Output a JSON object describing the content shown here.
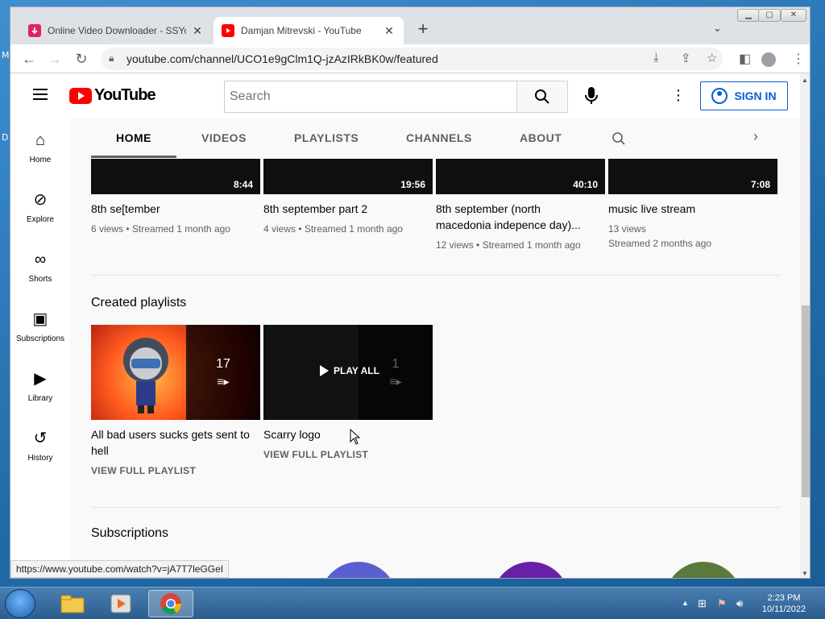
{
  "desktop": {
    "fragments": [
      "M",
      "D"
    ]
  },
  "browser": {
    "tabs": [
      {
        "title": "Online Video Downloader - SSYo",
        "active": false
      },
      {
        "title": "Damjan Mitrevski - YouTube",
        "active": true
      }
    ],
    "new_tab": "+",
    "url": "youtube.com/channel/UCO1e9gClm1Q-jzAzIRkBK0w/featured",
    "status_url": "https://www.youtube.com/watch?v=jA7T7leGGeI"
  },
  "yt": {
    "logo_text": "YouTube",
    "search_placeholder": "Search",
    "sign_in": "SIGN IN",
    "guide": [
      {
        "label": "Home",
        "icon": "home-icon"
      },
      {
        "label": "Explore",
        "icon": "compass-icon"
      },
      {
        "label": "Shorts",
        "icon": "shorts-icon"
      },
      {
        "label": "Subscriptions",
        "icon": "subscriptions-icon"
      },
      {
        "label": "Library",
        "icon": "library-icon"
      },
      {
        "label": "History",
        "icon": "history-icon"
      }
    ],
    "channel_tabs": [
      "HOME",
      "VIDEOS",
      "PLAYLISTS",
      "CHANNELS",
      "ABOUT"
    ],
    "videos": [
      {
        "title": "8th se[tember",
        "duration": "8:44",
        "views": "6 views",
        "streamed": "Streamed 1 month ago"
      },
      {
        "title": "8th september part 2",
        "duration": "19:56",
        "views": "4 views",
        "streamed": "Streamed 1 month ago"
      },
      {
        "title": "8th september (north macedonia indepence day)...",
        "duration": "40:10",
        "views": "12 views",
        "streamed": "Streamed 1 month ago"
      },
      {
        "title": "music live stream",
        "duration": "7:08",
        "views": "13 views",
        "streamed": "Streamed 2 months ago"
      }
    ],
    "created_playlists_heading": "Created playlists",
    "playlists": [
      {
        "title": "All bad users sucks gets sent to hell",
        "count": "17",
        "link": "VIEW FULL PLAYLIST"
      },
      {
        "title": "Scarry logo",
        "count": "1",
        "link": "VIEW FULL PLAYLIST",
        "overlay": "PLAY ALL"
      }
    ],
    "subscriptions_heading": "Subscriptions"
  },
  "taskbar": {
    "time": "2:23 PM",
    "date": "10/11/2022"
  },
  "colors": {
    "yt_red": "#ff0000",
    "sign_in_blue": "#065fd4"
  }
}
